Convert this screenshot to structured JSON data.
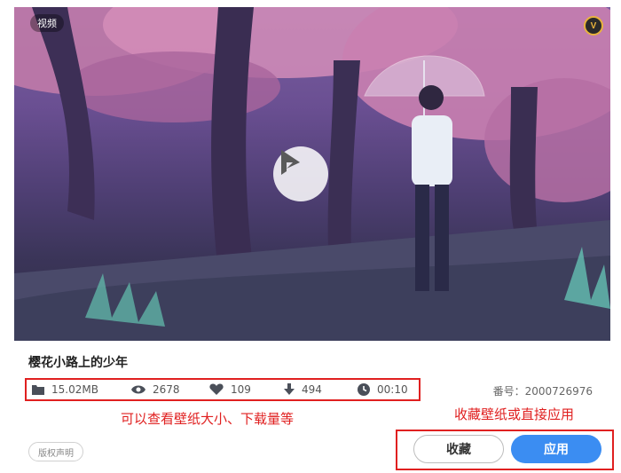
{
  "preview": {
    "type_badge": "视频",
    "vip_badge": "V"
  },
  "wallpaper": {
    "title": "樱花小路上的少年",
    "serial": "番号：2000726976"
  },
  "stats": [
    {
      "icon": "folder-icon",
      "value": "15.02MB"
    },
    {
      "icon": "eye-icon",
      "value": "2678"
    },
    {
      "icon": "heart-icon",
      "value": "109"
    },
    {
      "icon": "download-icon",
      "value": "494"
    },
    {
      "icon": "clock-icon",
      "value": "00:10"
    }
  ],
  "annotations": {
    "left": "可以查看壁纸大小、下载量等",
    "right": "收藏壁纸或直接应用"
  },
  "actions": {
    "copyright": "版权声明",
    "favorite": "收藏",
    "apply": "应用"
  },
  "colors": {
    "accent": "#3b8df2",
    "annotation": "#e02020"
  }
}
